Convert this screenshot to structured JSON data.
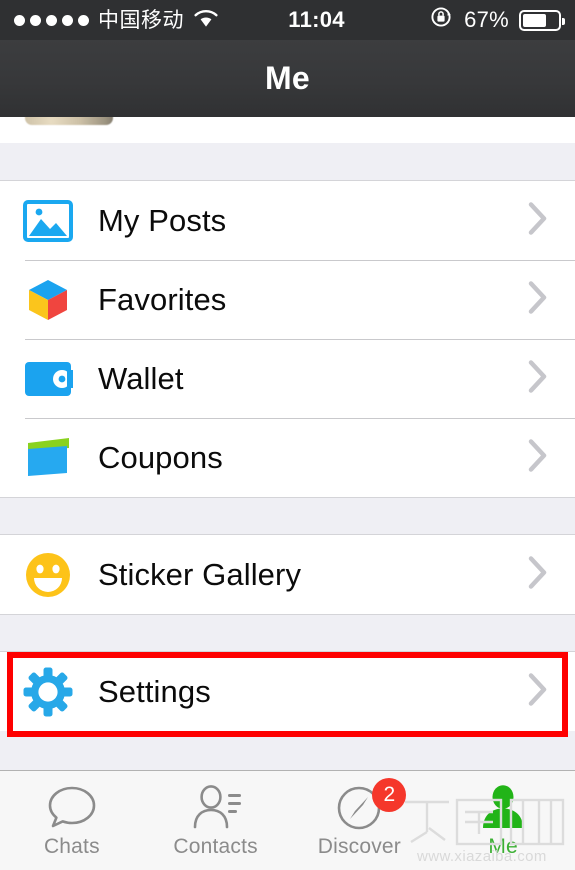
{
  "status_bar": {
    "signal_dots": 5,
    "carrier": "中国移动",
    "wifi_icon": "wifi-icon",
    "time": "11:04",
    "rotation_lock_icon": "rotation-lock-icon",
    "battery_percent": "67%",
    "battery_level": 67
  },
  "nav": {
    "title": "Me"
  },
  "sections": [
    {
      "id": "media",
      "rows": [
        {
          "id": "my-posts",
          "label": "My Posts",
          "icon": "photo-icon",
          "icon_color": "#1aa8f0",
          "chevron": "chevron-right-icon"
        },
        {
          "id": "favorites",
          "label": "Favorites",
          "icon": "cube-icon",
          "icon_color": "#1aa8f0",
          "chevron": "chevron-right-icon"
        },
        {
          "id": "wallet",
          "label": "Wallet",
          "icon": "wallet-icon",
          "icon_color": "#1aa8f0",
          "chevron": "chevron-right-icon"
        },
        {
          "id": "coupons",
          "label": "Coupons",
          "icon": "card-icon",
          "icon_color": "#1aa8f0",
          "chevron": "chevron-right-icon"
        }
      ]
    },
    {
      "id": "stickers",
      "rows": [
        {
          "id": "sticker-gallery",
          "label": "Sticker Gallery",
          "icon": "smiley-icon",
          "icon_color": "#fdc319",
          "chevron": "chevron-right-icon"
        }
      ]
    },
    {
      "id": "settings",
      "highlighted": true,
      "rows": [
        {
          "id": "settings",
          "label": "Settings",
          "icon": "gear-icon",
          "icon_color": "#27a8e8",
          "chevron": "chevron-right-icon"
        }
      ]
    }
  ],
  "highlight": {
    "color": "#fe0000",
    "target": "Settings"
  },
  "tabbar": {
    "tabs": [
      {
        "id": "chats",
        "label": "Chats",
        "icon": "chat-bubble-icon",
        "active": false,
        "badge": ""
      },
      {
        "id": "contacts",
        "label": "Contacts",
        "icon": "contacts-icon",
        "active": false,
        "badge": ""
      },
      {
        "id": "discover",
        "label": "Discover",
        "icon": "compass-icon",
        "active": false,
        "badge": "2"
      },
      {
        "id": "me",
        "label": "Me",
        "icon": "person-icon",
        "active": true,
        "badge": ""
      }
    ],
    "active_color": "#3cb034",
    "inactive_color": "#8b8b8b",
    "badge_color": "#f5372b"
  },
  "watermark": {
    "logo_text": "下载吧",
    "url": "www.xiazaiba.com"
  }
}
